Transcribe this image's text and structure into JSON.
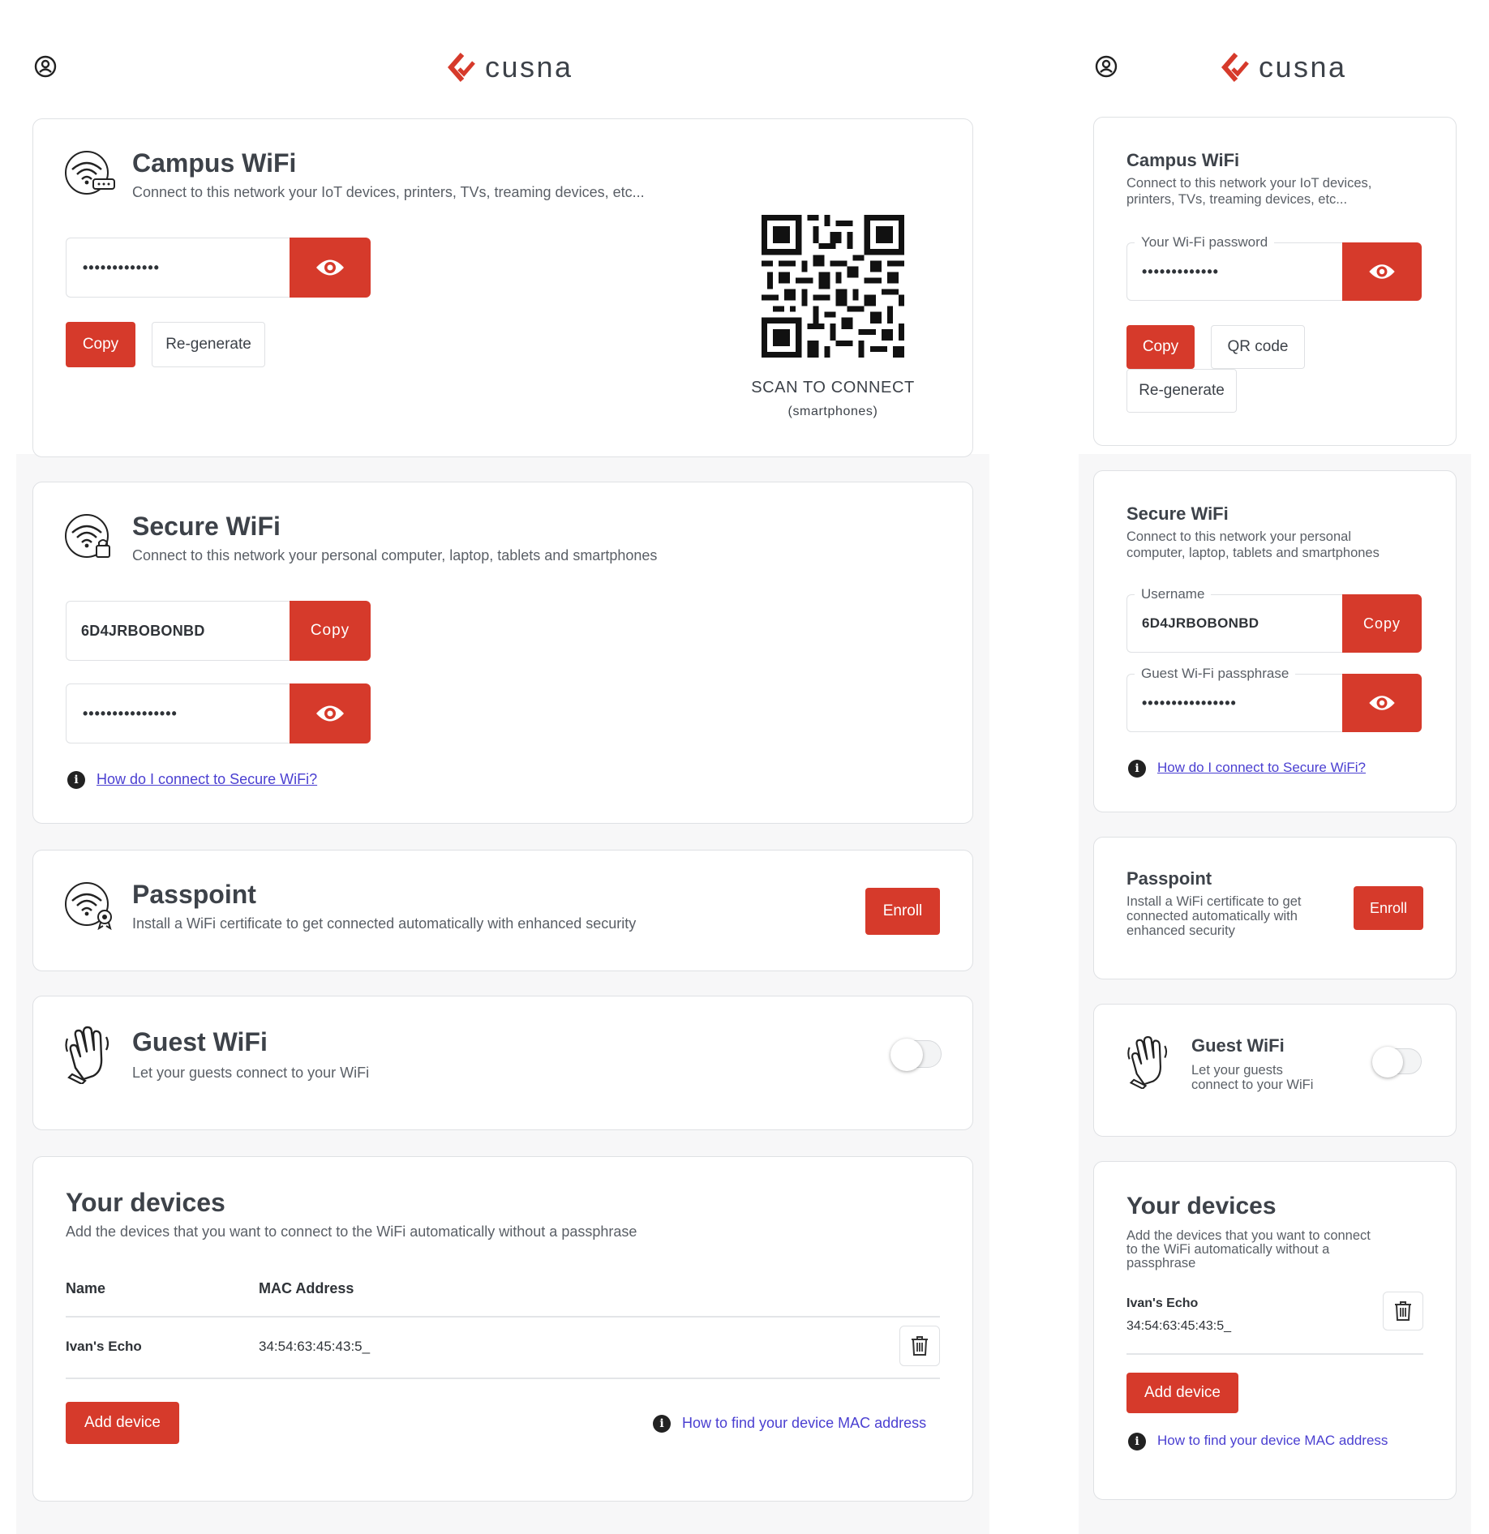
{
  "brand": {
    "name": "cusna",
    "accent": "#d63a2b",
    "icon": "cusna-chevron-logo",
    "user_icon": "user-circle-icon"
  },
  "desktop": {
    "campus": {
      "title": "Campus WiFi",
      "description": "Connect to this network your IoT devices, printers, TVs, treaming devices, etc...",
      "password": "•••••••••••••",
      "copy_label": "Copy",
      "regenerate_label": "Re-generate",
      "qr_caption": "SCAN TO CONNECT",
      "qr_subcaption": "(smartphones)"
    },
    "secure": {
      "title": "Secure WiFi",
      "description": "Connect to this network your personal computer, laptop, tablets and smartphones",
      "username": "6D4JRBOBONBD",
      "copy_label": "Copy",
      "passphrase": "••••••••••••••••",
      "help_link": "How do I connect to Secure WiFi?"
    },
    "passpoint": {
      "title": "Passpoint",
      "description": "Install a WiFi certificate to get connected automatically with enhanced security",
      "enroll_label": "Enroll"
    },
    "guest": {
      "title": "Guest WiFi",
      "description": "Let your guests connect to your WiFi",
      "enabled": false
    },
    "devices": {
      "title": "Your devices",
      "description": "Add the devices that you want to connect to the WiFi automatically without a passphrase",
      "columns": [
        "Name",
        "MAC Address"
      ],
      "rows": [
        {
          "name": "Ivan's Echo",
          "mac": "34:54:63:45:43:5_"
        }
      ],
      "add_label": "Add device",
      "help_link": "How to find your device MAC address"
    }
  },
  "mobile": {
    "campus": {
      "title": "Campus WiFi",
      "description_line1": "Connect to this network your IoT devices,",
      "description_line2": "printers, TVs, treaming devices, etc...",
      "password_label": "Your Wi-Fi password",
      "password": "•••••••••••••",
      "copy_label": "Copy",
      "qr_label": "QR code",
      "regenerate_label": "Re-generate"
    },
    "secure": {
      "title": "Secure WiFi",
      "description_line1": "Connect to this network your personal",
      "description_line2": "computer, laptop, tablets and smartphones",
      "username_label": "Username",
      "username": "6D4JRBOBONBD",
      "copy_label": "Copy",
      "passphrase_label": "Guest Wi-Fi passphrase",
      "passphrase": "••••••••••••••••",
      "help_link": "How do I connect to Secure WiFi?"
    },
    "passpoint": {
      "title": "Passpoint",
      "description_line1": "Install a WiFi certificate to get",
      "description_line2": "connected automatically with",
      "description_line3": "enhanced security",
      "enroll_label": "Enroll"
    },
    "guest": {
      "title": "Guest WiFi",
      "description_line1": "Let your guests",
      "description_line2": "connect to your WiFi",
      "enabled": false
    },
    "devices": {
      "title": "Your devices",
      "description_line1": "Add the devices that you want to connect",
      "description_line2": "to the WiFi automatically without a",
      "description_line3": "passphrase",
      "device_name": "Ivan's Echo",
      "device_mac": "34:54:63:45:43:5_",
      "add_label": "Add device",
      "help_link": "How to find your device MAC address"
    }
  }
}
